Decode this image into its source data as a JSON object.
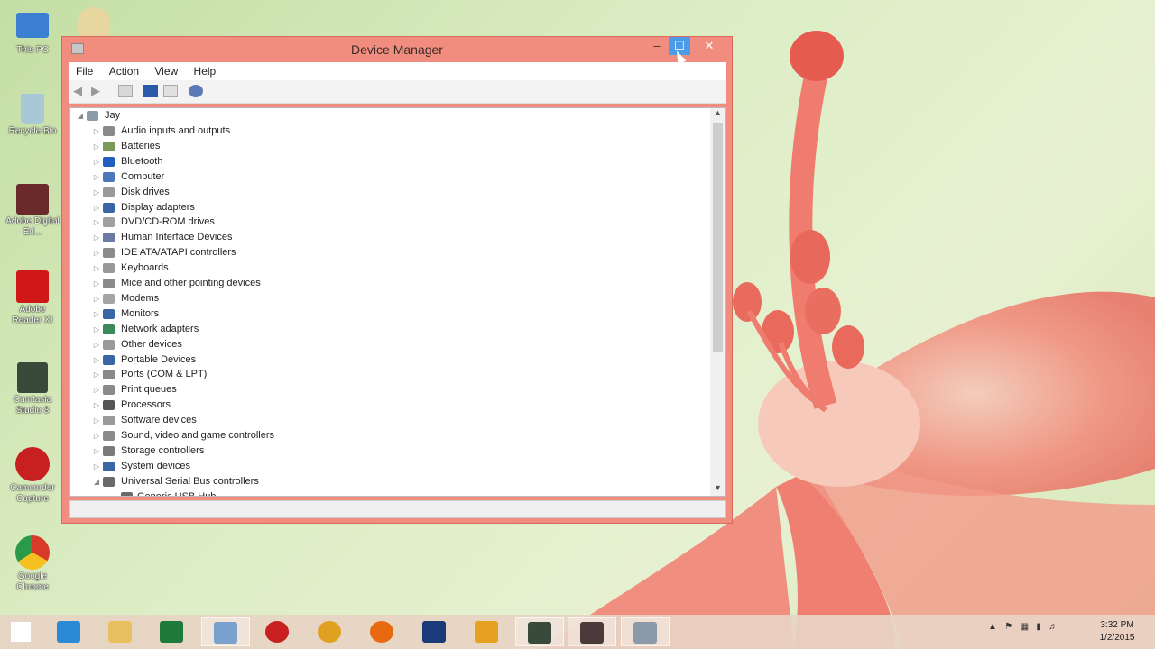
{
  "window": {
    "title": "Device Manager",
    "min_label": "–",
    "max_label": "☐",
    "close_label": "✕"
  },
  "menu": [
    "File",
    "Action",
    "View",
    "Help"
  ],
  "tree": {
    "root": "Jay",
    "categories": [
      {
        "label": "Audio inputs and outputs",
        "color": "#8a8a8a"
      },
      {
        "label": "Batteries",
        "color": "#7a9a5a"
      },
      {
        "label": "Bluetooth",
        "color": "#1f5fbf"
      },
      {
        "label": "Computer",
        "color": "#4a78b8"
      },
      {
        "label": "Disk drives",
        "color": "#9a9a9a"
      },
      {
        "label": "Display adapters",
        "color": "#3a66a8"
      },
      {
        "label": "DVD/CD-ROM drives",
        "color": "#a0a0a0"
      },
      {
        "label": "Human Interface Devices",
        "color": "#6a7aa0"
      },
      {
        "label": "IDE ATA/ATAPI controllers",
        "color": "#8b8b8b"
      },
      {
        "label": "Keyboards",
        "color": "#999999"
      },
      {
        "label": "Mice and other pointing devices",
        "color": "#8a8a8a"
      },
      {
        "label": "Modems",
        "color": "#a4a4a4"
      },
      {
        "label": "Monitors",
        "color": "#3a66a8"
      },
      {
        "label": "Network adapters",
        "color": "#3a8a5a"
      },
      {
        "label": "Other devices",
        "color": "#9a9a9a"
      },
      {
        "label": "Portable Devices",
        "color": "#3a66a8"
      },
      {
        "label": "Ports (COM & LPT)",
        "color": "#8a8a8a"
      },
      {
        "label": "Print queues",
        "color": "#8a8a8a"
      },
      {
        "label": "Processors",
        "color": "#555555"
      },
      {
        "label": "Software devices",
        "color": "#9a9a9a"
      },
      {
        "label": "Sound, video and game controllers",
        "color": "#8a8a8a"
      },
      {
        "label": "Storage controllers",
        "color": "#7a7a7a"
      },
      {
        "label": "System devices",
        "color": "#3a66a8"
      },
      {
        "label": "Universal Serial Bus controllers",
        "color": "#6a6a6a"
      }
    ],
    "child": "Generic USB Hub"
  },
  "desktop": [
    {
      "label": "This PC",
      "color": "#3a7fd0"
    },
    {
      "label": "Recycle Bin",
      "color": "#a8c8d8"
    },
    {
      "label": "Adobe Digital Ed...",
      "color": "#6a2a2a"
    },
    {
      "label": "Adobe Reader XI",
      "color": "#d01818"
    },
    {
      "label": "Camtasia Studio 8",
      "color": "#3a4a3a"
    },
    {
      "label": "Camcorder Capture",
      "color": "#c82020"
    },
    {
      "label": "Google Chrome",
      "color": "#e0a020"
    }
  ],
  "taskbar": {
    "items": [
      {
        "name": "start",
        "color": "#ffffff"
      },
      {
        "name": "internet-explorer",
        "color": "#2a8ad8"
      },
      {
        "name": "file-explorer",
        "color": "#e8c060"
      },
      {
        "name": "excel",
        "color": "#1e7b3a"
      },
      {
        "name": "paint",
        "color": "#7aa0d0"
      },
      {
        "name": "camcorder",
        "color": "#c82020"
      },
      {
        "name": "chrome",
        "color": "#e0a020"
      },
      {
        "name": "firefox",
        "color": "#e86a10"
      },
      {
        "name": "photoshop",
        "color": "#1a3a7a"
      },
      {
        "name": "outlook",
        "color": "#e8a020"
      },
      {
        "name": "camtasia",
        "color": "#3a4a3a"
      },
      {
        "name": "camtasia-recorder",
        "color": "#4a3a3a"
      },
      {
        "name": "device-manager",
        "color": "#8a9aa8"
      }
    ],
    "time": "3:32 PM",
    "date": "1/2/2015"
  }
}
